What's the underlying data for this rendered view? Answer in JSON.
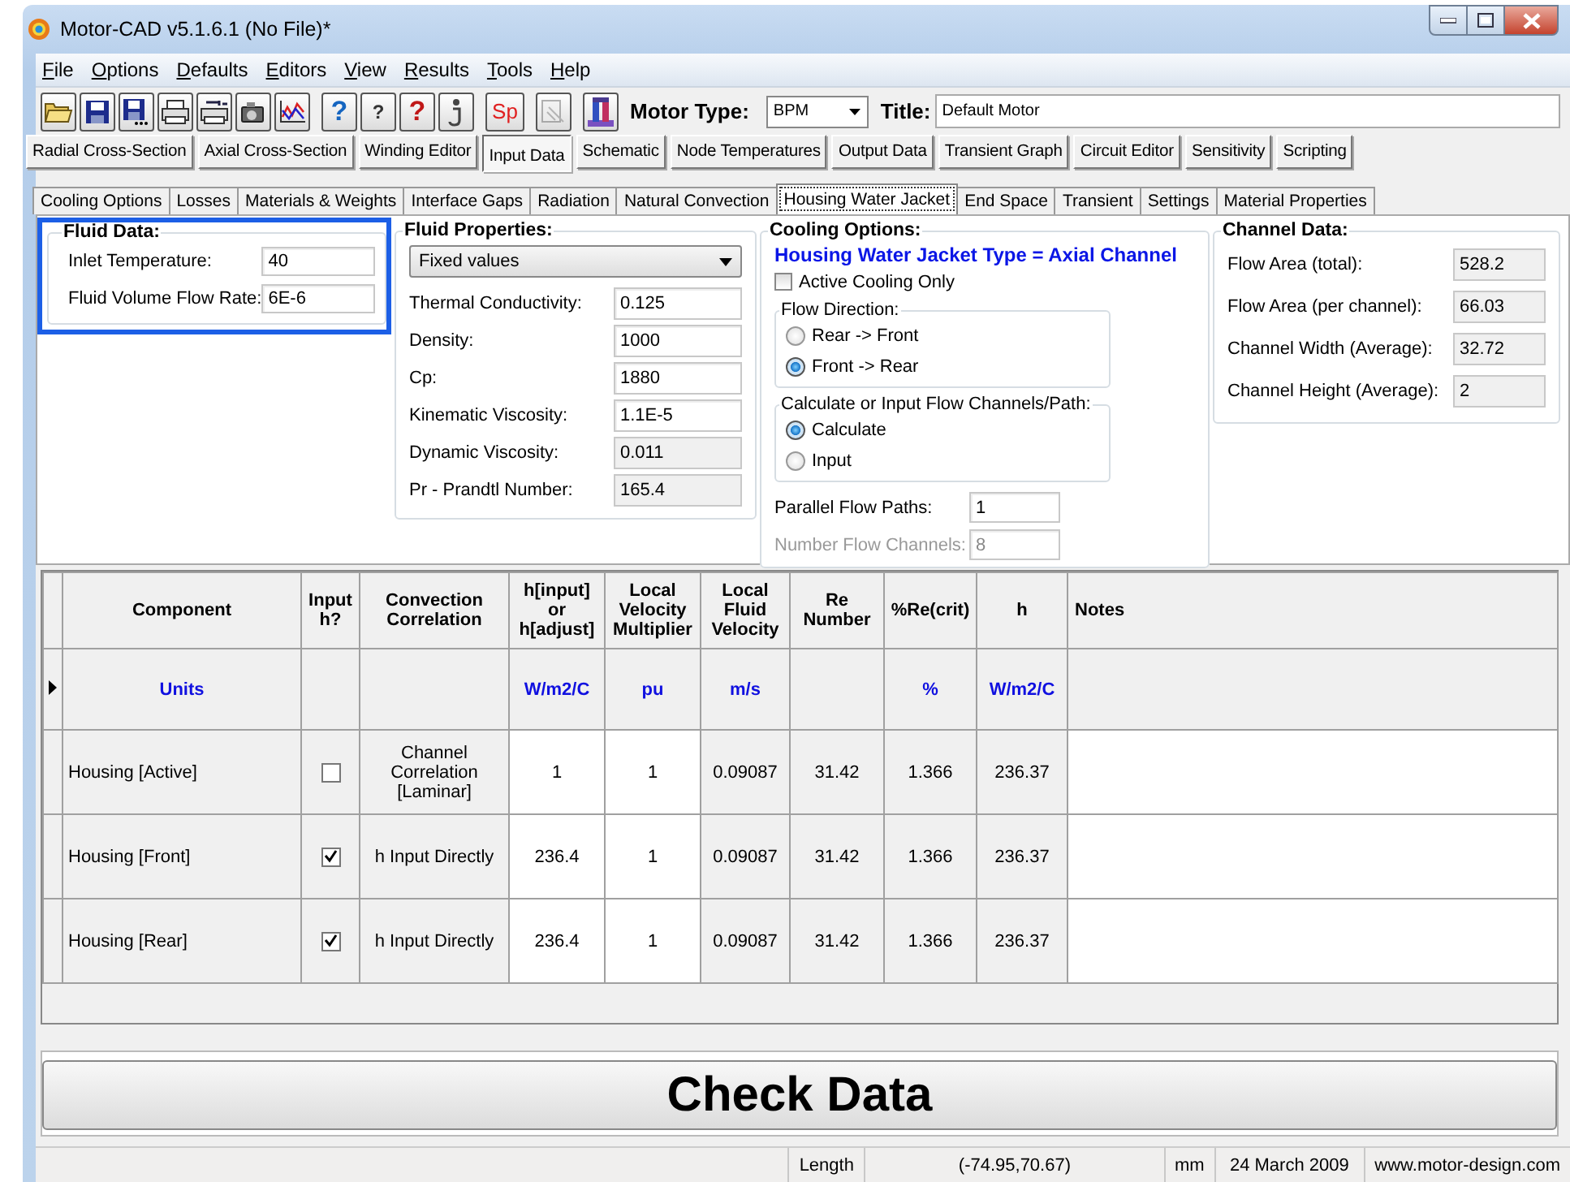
{
  "window": {
    "title": "Motor-CAD v5.1.6.1 (No File)*"
  },
  "menu": [
    "File",
    "Options",
    "Defaults",
    "Editors",
    "View",
    "Results",
    "Tools",
    "Help"
  ],
  "toolbar": [
    [
      {
        "kind": "open"
      },
      {
        "kind": "save"
      },
      {
        "kind": "save_as"
      },
      {
        "kind": "print"
      },
      {
        "kind": "print_setup"
      },
      {
        "kind": "export"
      },
      {
        "kind": "graph"
      }
    ],
    [
      {
        "kind": "help",
        "glyph": "?"
      },
      {
        "kind": "context_help",
        "glyph": "?"
      },
      {
        "kind": "help_red",
        "glyph": "?"
      },
      {
        "kind": "info"
      }
    ],
    [
      {
        "kind": "text",
        "glyph": "Sp"
      }
    ],
    [
      {
        "kind": "paste"
      }
    ],
    [
      {
        "kind": "motor"
      }
    ]
  ],
  "motor_type": {
    "label": "Motor Type:",
    "value": "BPM"
  },
  "title_field": {
    "label": "Title:",
    "value": "Default Motor"
  },
  "main_tabs": [
    {
      "label": "Radial Cross-Section",
      "selected": false
    },
    {
      "label": "Axial Cross-Section",
      "selected": false
    },
    {
      "label": "Winding Editor",
      "selected": false
    },
    {
      "label": "Input Data",
      "selected": true
    },
    {
      "label": "Schematic",
      "selected": false
    },
    {
      "label": "Node Temperatures",
      "selected": false
    },
    {
      "label": "Output Data",
      "selected": false
    },
    {
      "label": "Transient Graph",
      "selected": false
    },
    {
      "label": "Circuit Editor",
      "selected": false
    },
    {
      "label": "Sensitivity",
      "selected": false
    },
    {
      "label": "Scripting",
      "selected": false
    }
  ],
  "sub_tabs": [
    {
      "label": "Cooling Options",
      "selected": false
    },
    {
      "label": "Losses",
      "selected": false
    },
    {
      "label": "Materials & Weights",
      "selected": false
    },
    {
      "label": "Interface Gaps",
      "selected": false
    },
    {
      "label": "Radiation",
      "selected": false
    },
    {
      "label": "Natural Convection",
      "selected": false
    },
    {
      "label": "Housing Water Jacket",
      "selected": true
    },
    {
      "label": "End Space",
      "selected": false
    },
    {
      "label": "Transient",
      "selected": false
    },
    {
      "label": "Settings",
      "selected": false
    },
    {
      "label": "Material Properties",
      "selected": false
    }
  ],
  "fluid_data": {
    "title": "Fluid Data:",
    "focused": true,
    "fields": [
      {
        "label": "Inlet Temperature:",
        "value": "40"
      },
      {
        "label": "Fluid Volume Flow Rate:",
        "value": "6E-6"
      }
    ]
  },
  "fluid_properties": {
    "title": "Fluid Properties:",
    "mode": "Fixed values",
    "fields": [
      {
        "label": "Thermal Conductivity:",
        "value": "0.125",
        "readonly": false
      },
      {
        "label": "Density:",
        "value": "1000",
        "readonly": false
      },
      {
        "label": "Cp:",
        "value": "1880",
        "readonly": false
      },
      {
        "label": "Kinematic Viscosity:",
        "value": "1.1E-5",
        "readonly": false
      },
      {
        "label": "Dynamic Viscosity:",
        "value": "0.011",
        "readonly": true
      },
      {
        "label": "Pr - Prandtl Number:",
        "value": "165.4",
        "readonly": true
      }
    ]
  },
  "cooling_options": {
    "title": "Cooling Options:",
    "type_text": "Housing Water Jacket Type = Axial Channel",
    "active_cooling_only": {
      "label": "Active Cooling Only",
      "checked": false
    },
    "groups": [
      {
        "title": "Flow Direction:",
        "options": [
          {
            "label": "Rear -> Front",
            "selected": false
          },
          {
            "label": "Front -> Rear",
            "selected": true
          }
        ]
      },
      {
        "title": "Calculate or Input Flow Channels/Path:",
        "options": [
          {
            "label": "Calculate",
            "selected": true
          },
          {
            "label": "Input",
            "selected": false
          }
        ]
      }
    ],
    "fields": [
      {
        "label": "Parallel Flow Paths:",
        "value": "1",
        "disabled": false
      },
      {
        "label": "Number Flow Channels:",
        "value": "8",
        "disabled": true
      }
    ]
  },
  "channel_data": {
    "title": "Channel Data:",
    "fields": [
      {
        "label": "Flow Area (total):",
        "value": "528.2"
      },
      {
        "label": "Flow Area (per channel):",
        "value": "66.03"
      },
      {
        "label": "Channel Width (Average):",
        "value": "32.72"
      },
      {
        "label": "Channel Height (Average):",
        "value": "2"
      }
    ]
  },
  "table": {
    "columns": [
      {
        "label": "Component",
        "editable": false
      },
      {
        "label": "Input h?",
        "editable": false
      },
      {
        "label": "Convection Correlation",
        "editable": false
      },
      {
        "label": "h[input] or h[adjust]",
        "editable": true
      },
      {
        "label": "Local Velocity Multiplier",
        "editable": true
      },
      {
        "label": "Local Fluid Velocity",
        "editable": false
      },
      {
        "label": "Re Number",
        "editable": false
      },
      {
        "label": "%Re(crit)",
        "editable": false
      },
      {
        "label": "h",
        "editable": false
      },
      {
        "label": "Notes",
        "editable": true
      }
    ],
    "rows": [
      {
        "kind": "units",
        "current": true,
        "cells": [
          "Units",
          null,
          null,
          "W/m2/C",
          "pu",
          "m/s",
          null,
          "%",
          "W/m2/C",
          null
        ]
      },
      {
        "kind": "data",
        "current": false,
        "cells": [
          "Housing [Active]",
          false,
          "Channel Correlation [Laminar]",
          "1",
          "1",
          "0.09087",
          "31.42",
          "1.366",
          "236.37",
          null
        ]
      },
      {
        "kind": "data",
        "current": false,
        "cells": [
          "Housing [Front]",
          true,
          "h Input Directly",
          "236.4",
          "1",
          "0.09087",
          "31.42",
          "1.366",
          "236.37",
          null
        ]
      },
      {
        "kind": "data",
        "current": false,
        "cells": [
          "Housing [Rear]",
          true,
          "h Input Directly",
          "236.4",
          "1",
          "0.09087",
          "31.42",
          "1.366",
          "236.37",
          null
        ]
      }
    ]
  },
  "check_button": "Check Data",
  "status_bar": [
    "Length",
    "(-74.95,70.67)",
    "mm",
    "24 March 2009",
    "www.motor-design.com"
  ]
}
